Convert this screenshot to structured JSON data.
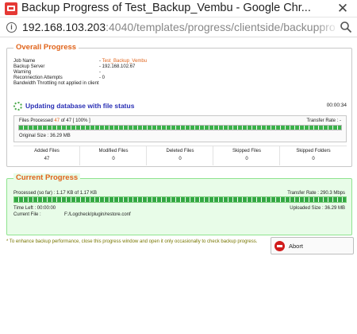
{
  "window": {
    "title": "Backup Progress of Test_Backup_Vembu - Google Chr...",
    "close_glyph": "✕",
    "app_icon": "chrome-window-icon"
  },
  "address_bar": {
    "host": "192.168.103.203",
    "path": ":4040/templates/progress/clientside/backupprogre...",
    "info_icon": "info-icon",
    "zoom_icon": "zoom-icon"
  },
  "overall": {
    "legend": "Overall Progress",
    "fields": [
      {
        "label": "Job Name",
        "value": "Test_Backup_Vembu",
        "highlight": true
      },
      {
        "label": "Backup Server",
        "value": "192.168.102.67"
      },
      {
        "label": "Warning",
        "value": ""
      },
      {
        "label": "Reconnection Attempts",
        "value": "0"
      }
    ],
    "throttling_text": "Bandwidth Throttling not applied in client",
    "status_text": "Updating database with file status",
    "elapsed": "00:00:34",
    "files_processed_prefix": "Files Processed",
    "files_processed_count": "47",
    "files_processed_suffix": "of 47 [ 100% ]",
    "transfer_rate": "Transfer Rate : -",
    "progress_fraction": 1.0,
    "original_size": "Original Size : 36.29 MB",
    "stats": [
      {
        "label": "Added Files",
        "value": "47"
      },
      {
        "label": "Modified Files",
        "value": "0"
      },
      {
        "label": "Deleted Files",
        "value": "0"
      },
      {
        "label": "Skipped Files",
        "value": "0"
      },
      {
        "label": "Skipped Folders",
        "value": "0"
      }
    ]
  },
  "current": {
    "legend": "Current Progress",
    "processed": "Processed (so far) : 1.17 KB of 1.17 KB",
    "transfer_rate": "Transfer Rate : 290.3 Mbps",
    "progress_fraction": 1.0,
    "time_left": "Time Left : 00:00:00",
    "uploaded_size": "Uploaded Size : 36.29 MB",
    "current_file_label": "Current File :",
    "current_file_value": "F:/Logcheck/plugin/restore.conf"
  },
  "footer": {
    "note": "* To enhance backup performance, close this progress window and open it only occasionally to check backup progress.",
    "abort_label": "Abort",
    "abort_icon": "abort-icon"
  },
  "colors": {
    "legend_orange": "#e0631a",
    "status_blue": "#2a30b5",
    "progress_green": "#3bb14a",
    "current_bg": "#e8fce8",
    "note_olive": "#777600",
    "abort_red": "#d11c1c"
  }
}
